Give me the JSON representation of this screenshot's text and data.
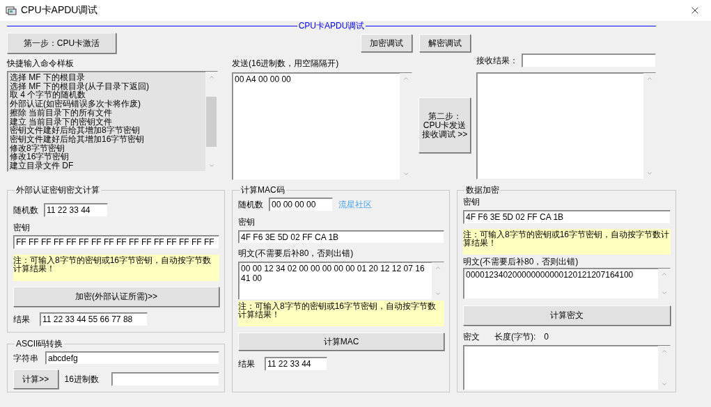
{
  "window": {
    "title": "CPU卡APDU调试"
  },
  "header": {
    "title": "CPU卡APDU调试"
  },
  "toolbar": {
    "step1_button": "第一步：CPU卡激活",
    "encrypt_button": "加密调试",
    "decrypt_button": "解密调试"
  },
  "command_samples": {
    "label": "快捷输入命令样板",
    "items": [
      "选择 MF 下的根目录",
      "选择 MF 下的根目录(从子目录下返回)",
      "取 4 个字节的随机数",
      "外部认证(如密码错误多次卡将作废)",
      "擦除 当前目录下的所有文件",
      "建立 当前目录下的密钥文件",
      "密钥文件建好后给其增加8字节密钥",
      "密钥文件建好后给其增加16字节密钥",
      "修改8字节密钥",
      "修改16字节密钥",
      "建立目录文件 DF"
    ]
  },
  "send": {
    "label": "发送(16进制数，用空隔隔开)",
    "value": "00 A4 00 00 00"
  },
  "step2_button": {
    "lines": [
      "第二步：",
      "CPU卡发送",
      "接收调试 >>"
    ]
  },
  "receive": {
    "label": "接收结果："
  },
  "external_auth": {
    "title": "外部认证密钥密文计算",
    "random_label": "随机数",
    "random_value": "11 22 33 44",
    "key_label": "密钥",
    "key_value": "FF FF FF FF FF FF FF FF FF FF FF FF FF FF FF FF",
    "note": "注：可输入8字节的密钥或16字节密钥，自动按字节数计算结果！",
    "button": "加密(外部认证所需)>>",
    "result_label": "结果",
    "result_value": "11 22 33 44 55 66 77 88"
  },
  "ascii": {
    "title": "ASCII码转换",
    "string_label": "字符串",
    "string_value": "abcdefg",
    "button": "计算>>",
    "hex_label": "16进制数"
  },
  "mac": {
    "title": "计算MAC码",
    "random_label": "随机数",
    "random_value": "00 00 00 00",
    "link": "流星社区",
    "key_label": "密钥",
    "key_value": "4F F6 3E 5D 02 FF CA 1B",
    "plain_label": "明文(不需要后补80，否则出错)",
    "plain_value": "00 00 12 34 02 00 00 00 00 00 01 20 12 12 07 16 41 00",
    "note": "注：可输入8字节的密钥或16字节密钥，自动按字节数计算结果！",
    "button": "计算MAC",
    "result_label": "结果",
    "result_value": "11 22 33 44"
  },
  "data_encrypt": {
    "title": "数据加密",
    "key_label": "密钥",
    "key_value": "4F F6 3E 5D 02 FF CA 1B",
    "note": "注：可输入8字节的密钥或16字节密钥，自动按字节数计算结果！",
    "plain_label": "明文(不需要后补80，否则出错)",
    "plain_value": "000012340200000000000120121207164100",
    "button": "计算密文",
    "cipher_label": "密文",
    "length_label": "长度(字节):",
    "length_value": "0"
  }
}
